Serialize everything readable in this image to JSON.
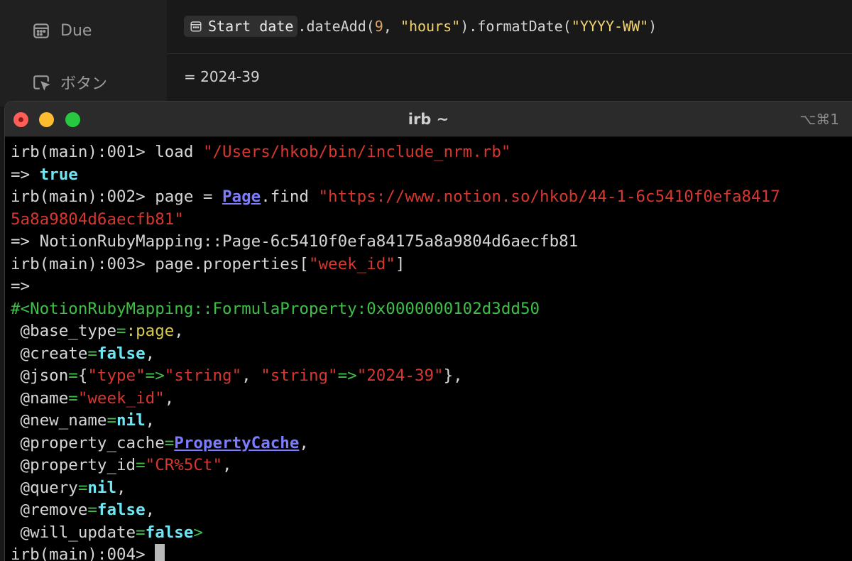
{
  "notion": {
    "sidebar": {
      "items": [
        {
          "label": "Due",
          "icon": "calendar-icon"
        },
        {
          "label": "ボタン",
          "icon": "cursor-click-icon"
        }
      ]
    },
    "formula": {
      "property_chip": "Start date",
      "tail_method1": ".dateAdd(",
      "arg_num": "9",
      "arg_sep": ", ",
      "arg_unit": "\"hours\"",
      "tail_method2": ").formatDate(",
      "arg_format": "\"YYYY-WW\"",
      "tail_close": ")",
      "result": "= 2024-39"
    }
  },
  "terminal": {
    "title": "irb ~",
    "shortcut": "⌥⌘1",
    "lines": [
      [
        {
          "t": "irb(main):001> load ",
          "c": "c-punc"
        },
        {
          "t": "\"/Users/hkob/bin/include_nrm.rb\"",
          "c": "c-str"
        }
      ],
      [
        {
          "t": "=> ",
          "c": "c-punc"
        },
        {
          "t": "true",
          "c": "c-true"
        }
      ],
      [
        {
          "t": "irb(main):002> page = ",
          "c": "c-punc"
        },
        {
          "t": "Page",
          "c": "c-class"
        },
        {
          "t": ".find ",
          "c": "c-punc"
        },
        {
          "t": "\"https://www.notion.so/hkob/44-1-6c5410f0efa8417",
          "c": "c-str"
        }
      ],
      [
        {
          "t": "5a8a9804d6aecfb81\"",
          "c": "c-str"
        }
      ],
      [
        {
          "t": "=> NotionRubyMapping::Page-6c5410f0efa84175a8a9804d6aecfb81",
          "c": "c-punc"
        }
      ],
      [
        {
          "t": "irb(main):003> page.properties[",
          "c": "c-punc"
        },
        {
          "t": "\"week_id\"",
          "c": "c-str"
        },
        {
          "t": "]",
          "c": "c-punc"
        }
      ],
      [
        {
          "t": "=>",
          "c": "c-punc"
        }
      ],
      [
        {
          "t": "#<NotionRubyMapping::FormulaProperty:0x0000000102d3dd50",
          "c": "c-obj"
        }
      ],
      [
        {
          "t": " @base_type",
          "c": "c-ivar"
        },
        {
          "t": "=",
          "c": "c-eq"
        },
        {
          "t": ":page",
          "c": "c-sym"
        },
        {
          "t": ",",
          "c": "c-punc"
        }
      ],
      [
        {
          "t": " @create",
          "c": "c-ivar"
        },
        {
          "t": "=",
          "c": "c-eq"
        },
        {
          "t": "false",
          "c": "c-true"
        },
        {
          "t": ",",
          "c": "c-punc"
        }
      ],
      [
        {
          "t": " @json",
          "c": "c-ivar"
        },
        {
          "t": "=",
          "c": "c-eq"
        },
        {
          "t": "{",
          "c": "c-punc"
        },
        {
          "t": "\"type\"",
          "c": "c-str"
        },
        {
          "t": "=>",
          "c": "c-eq"
        },
        {
          "t": "\"string\"",
          "c": "c-str"
        },
        {
          "t": ", ",
          "c": "c-punc"
        },
        {
          "t": "\"string\"",
          "c": "c-str"
        },
        {
          "t": "=>",
          "c": "c-eq"
        },
        {
          "t": "\"2024-39\"",
          "c": "c-str"
        },
        {
          "t": "},",
          "c": "c-punc"
        }
      ],
      [
        {
          "t": " @name",
          "c": "c-ivar"
        },
        {
          "t": "=",
          "c": "c-eq"
        },
        {
          "t": "\"week_id\"",
          "c": "c-str"
        },
        {
          "t": ",",
          "c": "c-punc"
        }
      ],
      [
        {
          "t": " @new_name",
          "c": "c-ivar"
        },
        {
          "t": "=",
          "c": "c-eq"
        },
        {
          "t": "nil",
          "c": "c-true"
        },
        {
          "t": ",",
          "c": "c-punc"
        }
      ],
      [
        {
          "t": " @property_cache",
          "c": "c-ivar"
        },
        {
          "t": "=",
          "c": "c-eq"
        },
        {
          "t": "PropertyCache",
          "c": "c-class"
        },
        {
          "t": ",",
          "c": "c-punc"
        }
      ],
      [
        {
          "t": " @property_id",
          "c": "c-ivar"
        },
        {
          "t": "=",
          "c": "c-eq"
        },
        {
          "t": "\"CR%5Ct\"",
          "c": "c-str"
        },
        {
          "t": ",",
          "c": "c-punc"
        }
      ],
      [
        {
          "t": " @query",
          "c": "c-ivar"
        },
        {
          "t": "=",
          "c": "c-eq"
        },
        {
          "t": "nil",
          "c": "c-true"
        },
        {
          "t": ",",
          "c": "c-punc"
        }
      ],
      [
        {
          "t": " @remove",
          "c": "c-ivar"
        },
        {
          "t": "=",
          "c": "c-eq"
        },
        {
          "t": "false",
          "c": "c-true"
        },
        {
          "t": ",",
          "c": "c-punc"
        }
      ],
      [
        {
          "t": " @will_update",
          "c": "c-ivar"
        },
        {
          "t": "=",
          "c": "c-eq"
        },
        {
          "t": "false",
          "c": "c-true"
        },
        {
          "t": ">",
          "c": "c-eq"
        }
      ]
    ],
    "prompt": "irb(main):004> "
  }
}
